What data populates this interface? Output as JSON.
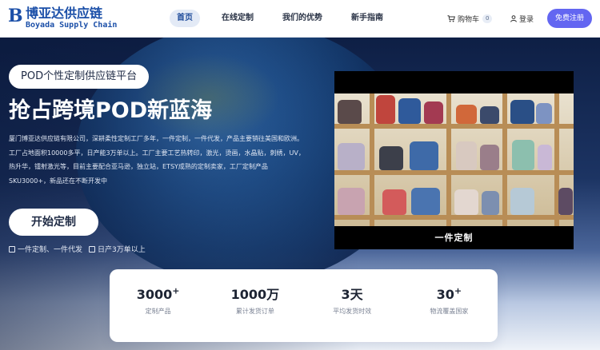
{
  "nav": {
    "logo_cn": "博亚达供应链",
    "logo_en": "Boyada Supply Chain",
    "links": [
      "首页",
      "在线定制",
      "我们的优势",
      "新手指南"
    ],
    "cart_label": "购物车",
    "cart_count": "0",
    "login_label": "登录",
    "register_label": "免费注册"
  },
  "hero": {
    "tag": "POD个性定制供应链平台",
    "headline": "抢占跨境POD新蓝海",
    "description": "厦门博亚达供应链有限公司，深耕柔性定制工厂多年，一件定制，一件代发，产品主要销往美国和欧洲。工厂占地面积10000多平，日产能3万单以上。工厂主要工艺热转印，激光，烫画，水晶贴，刺绣，UV，热升华，镭射激光等，目前主要配合亚马逊，独立站，ETSY成熟的定制卖家，工厂定制产品SKU3000+，新品还在不断开发中",
    "start_label": "开始定制",
    "features": [
      "一件定制、一件代发",
      "日产3万单以上"
    ]
  },
  "video": {
    "caption": "一件定制"
  },
  "stats": [
    {
      "value": "3000",
      "sup": "+",
      "label": "定制产品"
    },
    {
      "value": "1000万",
      "sup": "",
      "label": "累计发货订单"
    },
    {
      "value": "3天",
      "sup": "",
      "label": "平均发货时效"
    },
    {
      "value": "30",
      "sup": "+",
      "label": "物流覆盖国家"
    }
  ],
  "colors": {
    "brand": "#1b4fa8",
    "register": "#6366f1",
    "hero_dark": "#0e1f45"
  }
}
